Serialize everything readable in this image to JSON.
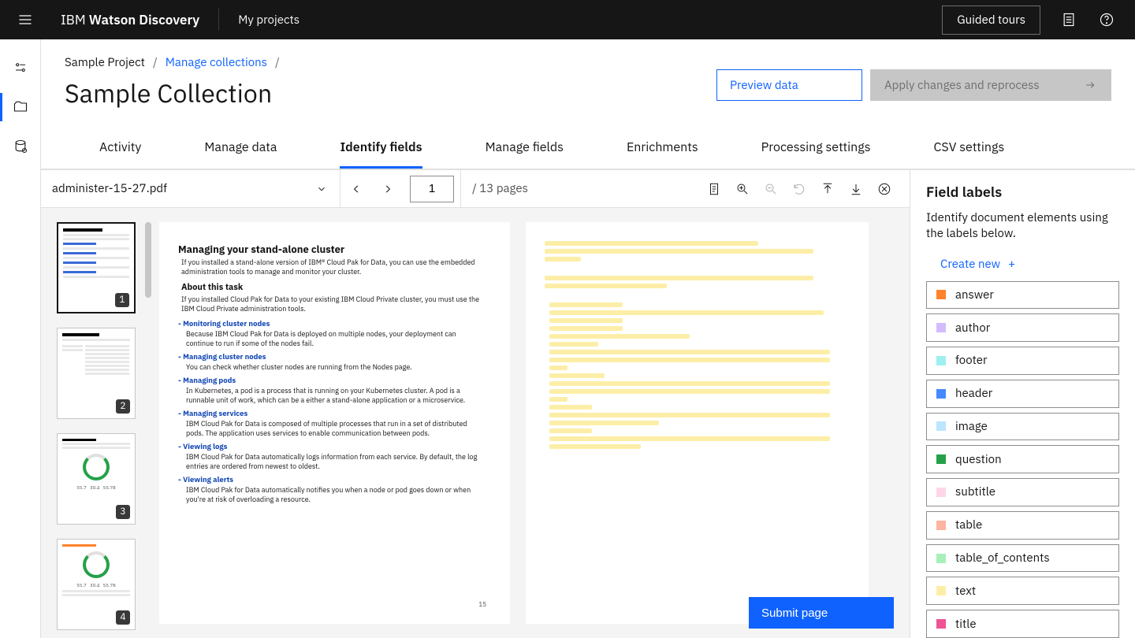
{
  "topbar": {
    "brand_prefix": "IBM ",
    "brand_bold": "Watson Discovery",
    "my_projects": "My projects",
    "guided_tours": "Guided tours"
  },
  "breadcrumb": {
    "project": "Sample Project",
    "manage_collections": "Manage collections"
  },
  "page_title": "Sample Collection",
  "buttons": {
    "preview": "Preview data",
    "apply": "Apply changes and reprocess",
    "submit": "Submit page"
  },
  "tabs": {
    "activity": "Activity",
    "manage_data": "Manage data",
    "identify_fields": "Identify fields",
    "manage_fields": "Manage fields",
    "enrichments": "Enrichments",
    "processing": "Processing settings",
    "csv": "CSV settings"
  },
  "toolbar": {
    "file": "administer-15-27.pdf",
    "page": "1",
    "total": "/ 13 pages"
  },
  "thumbs": [
    "1",
    "2",
    "3",
    "4"
  ],
  "doc": {
    "h1": "Managing your stand-alone cluster",
    "p1": "If you installed a stand-alone version of IBM® Cloud Pak for Data, you can use the embedded administration tools to manage and monitor your cluster.",
    "h2": "About this task",
    "p2": "If you installed Cloud Pak for Data to your existing IBM Cloud Private cluster, you must use the IBM Cloud Private administration tools.",
    "s1t": "- Monitoring cluster nodes",
    "s1d": "Because IBM Cloud Pak for Data is deployed on multiple nodes, your deployment can continue to run if some of the nodes fail.",
    "s2t": "- Managing cluster nodes",
    "s2d": "You can check whether cluster nodes are running from the Nodes page.",
    "s3t": "- Managing pods",
    "s3d": "In Kubernetes, a pod is a process that is running on your Kubernetes cluster. A pod is a runnable unit of work, which can be a either a stand-alone application or a microservice.",
    "s4t": "- Managing services",
    "s4d": "IBM Cloud Pak for Data is composed of multiple processes that run in a set of distributed pods. The application uses services to enable communication between pods.",
    "s5t": "- Viewing logs",
    "s5d": "IBM Cloud Pak for Data automatically logs information from each service. By default, the log entries are ordered from newest to oldest.",
    "s6t": "- Viewing alerts",
    "s6d": "IBM Cloud Pak for Data automatically notifies you when a node or pod goes down or when you're at risk of overloading a resource.",
    "pno": "15"
  },
  "right": {
    "heading": "Field labels",
    "blurb": "Identify document elements using the labels below.",
    "create": "Create new"
  },
  "labels": [
    {
      "name": "answer",
      "color": "#ff832b"
    },
    {
      "name": "author",
      "color": "#d4bbff"
    },
    {
      "name": "footer",
      "color": "#9ef0f0"
    },
    {
      "name": "header",
      "color": "#4589ff"
    },
    {
      "name": "image",
      "color": "#bae6ff"
    },
    {
      "name": "question",
      "color": "#24a148"
    },
    {
      "name": "subtitle",
      "color": "#ffd6e8"
    },
    {
      "name": "table",
      "color": "#ffb3a1"
    },
    {
      "name": "table_of_contents",
      "color": "#a7f0ba"
    },
    {
      "name": "text",
      "color": "#fdeea7"
    },
    {
      "name": "title",
      "color": "#ee5396"
    }
  ]
}
